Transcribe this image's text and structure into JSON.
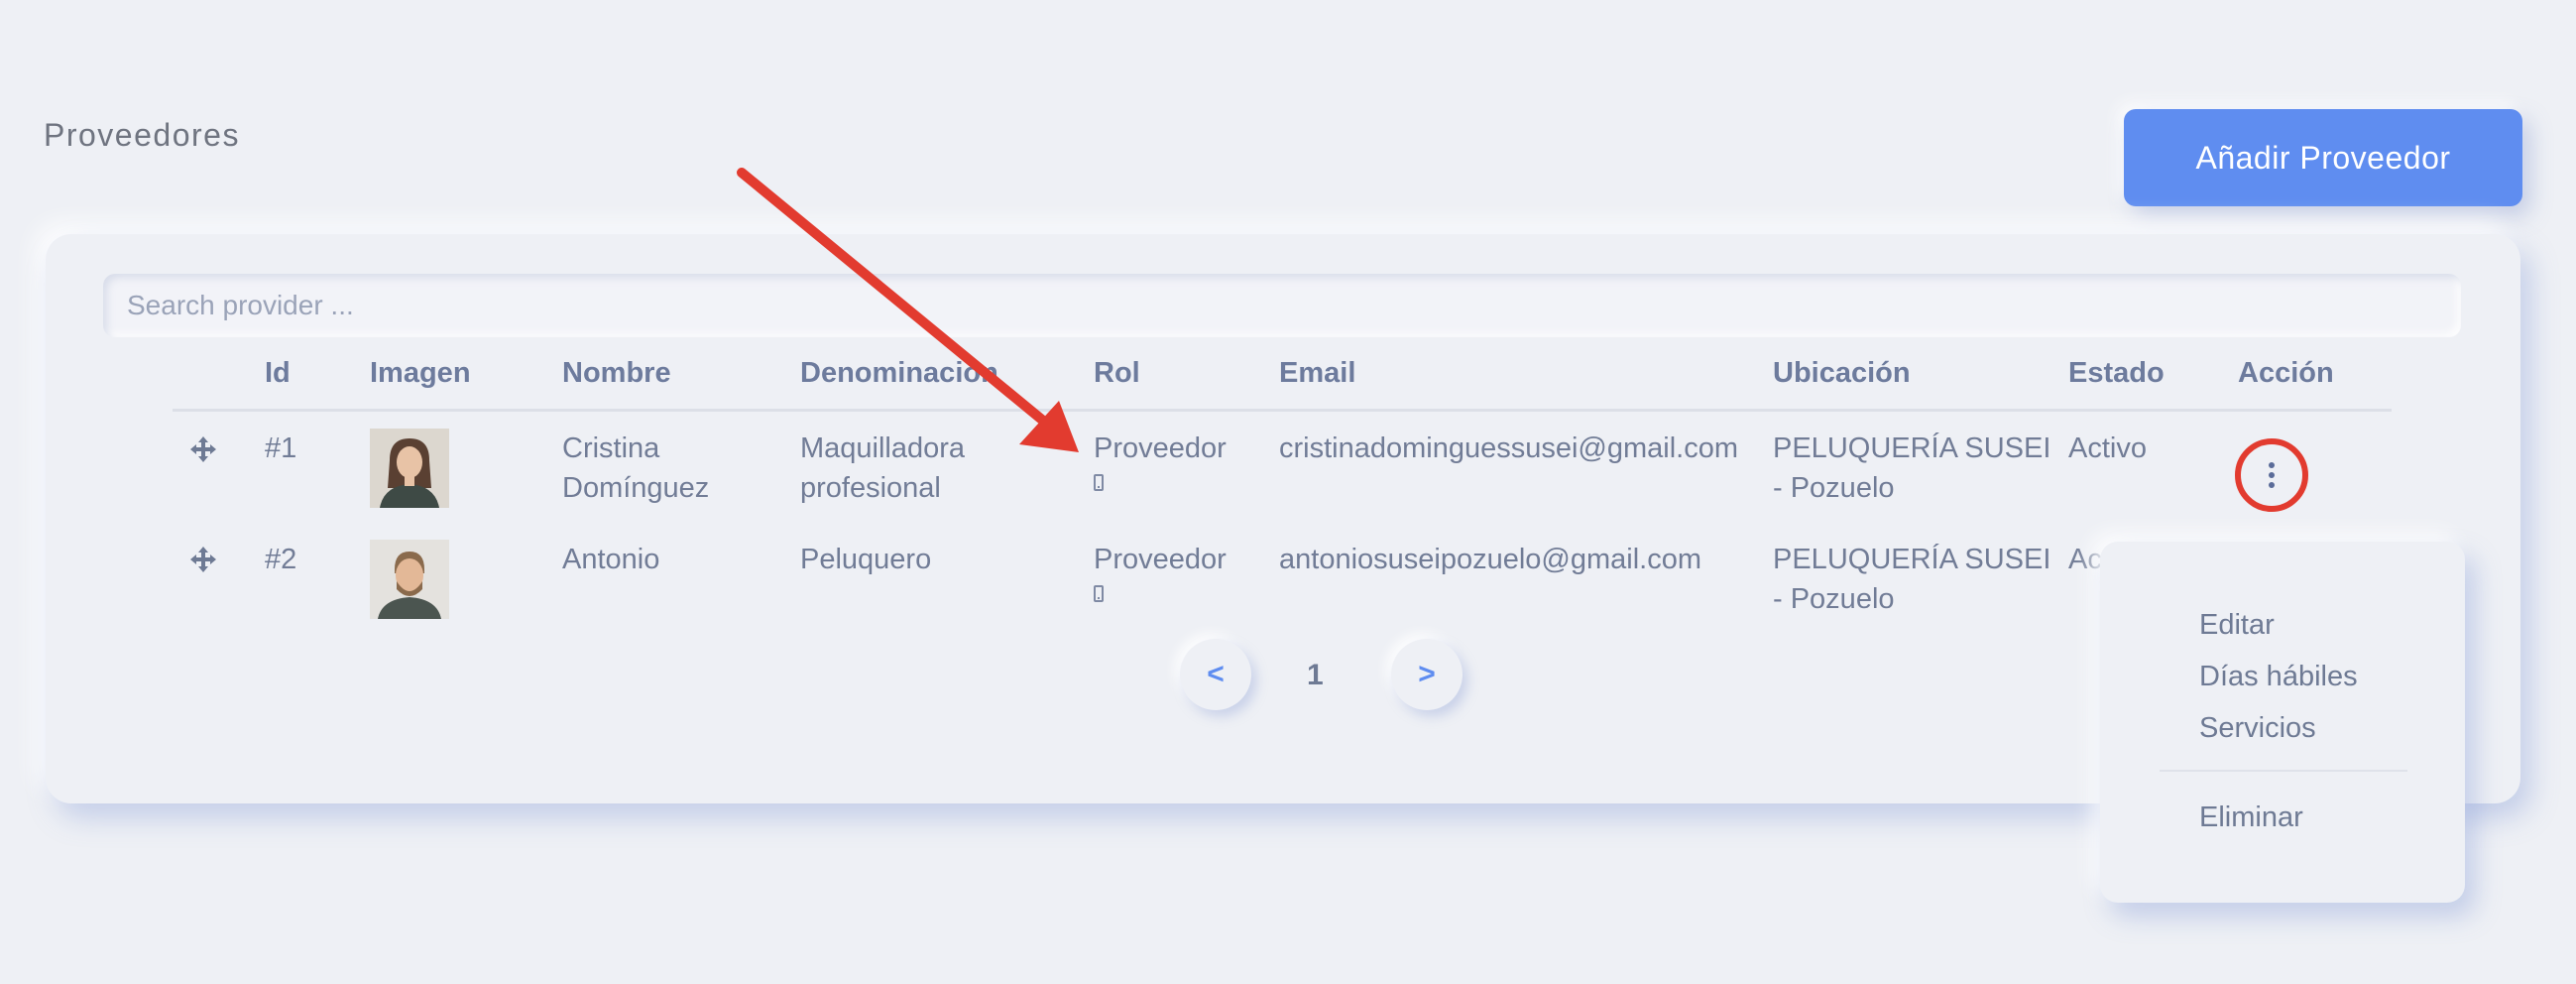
{
  "page": {
    "title": "Proveedores",
    "add_button": "Añadir Proveedor"
  },
  "search": {
    "placeholder": "Search provider ..."
  },
  "table": {
    "headers": {
      "id": "Id",
      "image": "Imagen",
      "name": "Nombre",
      "denomination": "Denominación",
      "role": "Rol",
      "email": "Email",
      "location": "Ubicación",
      "status": "Estado",
      "action": "Acción"
    },
    "rows": [
      {
        "id": "#1",
        "name_line1": "Cristina",
        "name_line2": "Domínguez",
        "denom_line1": "Maquilladora",
        "denom_line2": "profesional",
        "role": "Proveedor",
        "email": "cristinadominguessusei@gmail.com",
        "loc_line1": "PELUQUERÍA SUSEI",
        "loc_line2": "- Pozuelo",
        "status": "Activo"
      },
      {
        "id": "#2",
        "name_line1": "Antonio",
        "denom_line1": "Peluquero",
        "role": "Proveedor",
        "email": "antoniosuseipozuelo@gmail.com",
        "loc_line1": "PELUQUERÍA SUSEI",
        "loc_line2": "- Pozuelo",
        "status_partial": "Ac"
      }
    ]
  },
  "pagination": {
    "prev": "<",
    "page": "1",
    "next": ">"
  },
  "action_menu": {
    "items": [
      "Editar",
      "Días hábiles",
      "Servicios"
    ],
    "danger": "Eliminar"
  },
  "colors": {
    "accent": "#5f8df0",
    "annotation": "#e23b2f",
    "background": "#eef0f5"
  }
}
